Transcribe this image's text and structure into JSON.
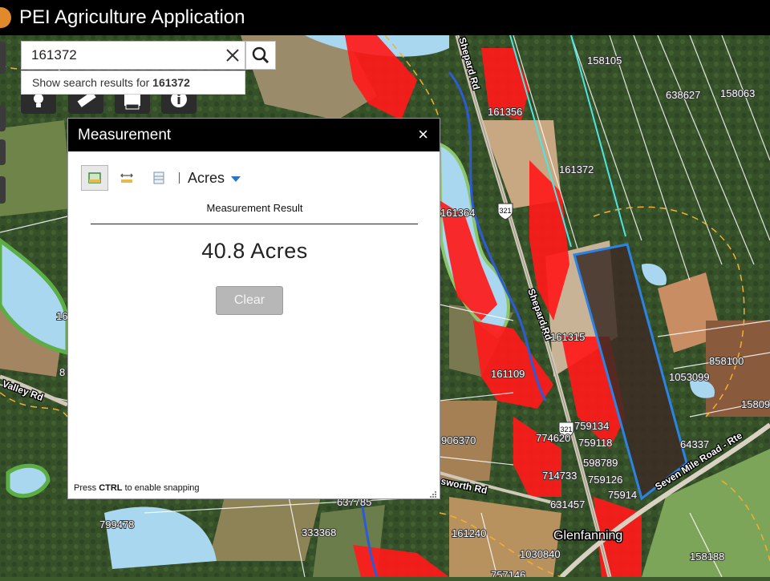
{
  "app": {
    "title": "PEI Agriculture Application"
  },
  "search": {
    "value": "161372",
    "suggestion_prefix": "Show search results for ",
    "suggestion_term": "161372"
  },
  "measurement": {
    "title": "Measurement",
    "close_glyph": "×",
    "unit": "Acres",
    "result_label": "Measurement Result",
    "result_value": "40.8 Acres",
    "clear_label": "Clear",
    "snap_hint_pre": "Press ",
    "snap_hint_key": "CTRL",
    "snap_hint_post": " to enable snapping"
  },
  "map": {
    "roads": [
      "Shepard Rd",
      "Seven Mile Road - Rte",
      "Valley Rd",
      "sworth Rd"
    ],
    "route_shields": [
      "321",
      "321"
    ],
    "place_label": "Glenfanning",
    "parcels": [
      "158105",
      "638627",
      "158063",
      "161356",
      "161372",
      "161364",
      "161315",
      "161109",
      "858100",
      "1053099",
      "15809",
      "759134",
      "774620",
      "759118",
      "906370",
      "64337",
      "598789",
      "714733",
      "759126",
      "75914",
      "637785",
      "799478",
      "631457",
      "333368",
      "161240",
      "1030840",
      "158188",
      "757146",
      "16",
      "8"
    ]
  },
  "colors": {
    "accent": "#2a74c9",
    "selection_fill": "#3c2c24",
    "selection_stroke": "#2b83e6",
    "wetland": "#ff1a1a",
    "boundary_cyan": "#4fe3e3"
  }
}
